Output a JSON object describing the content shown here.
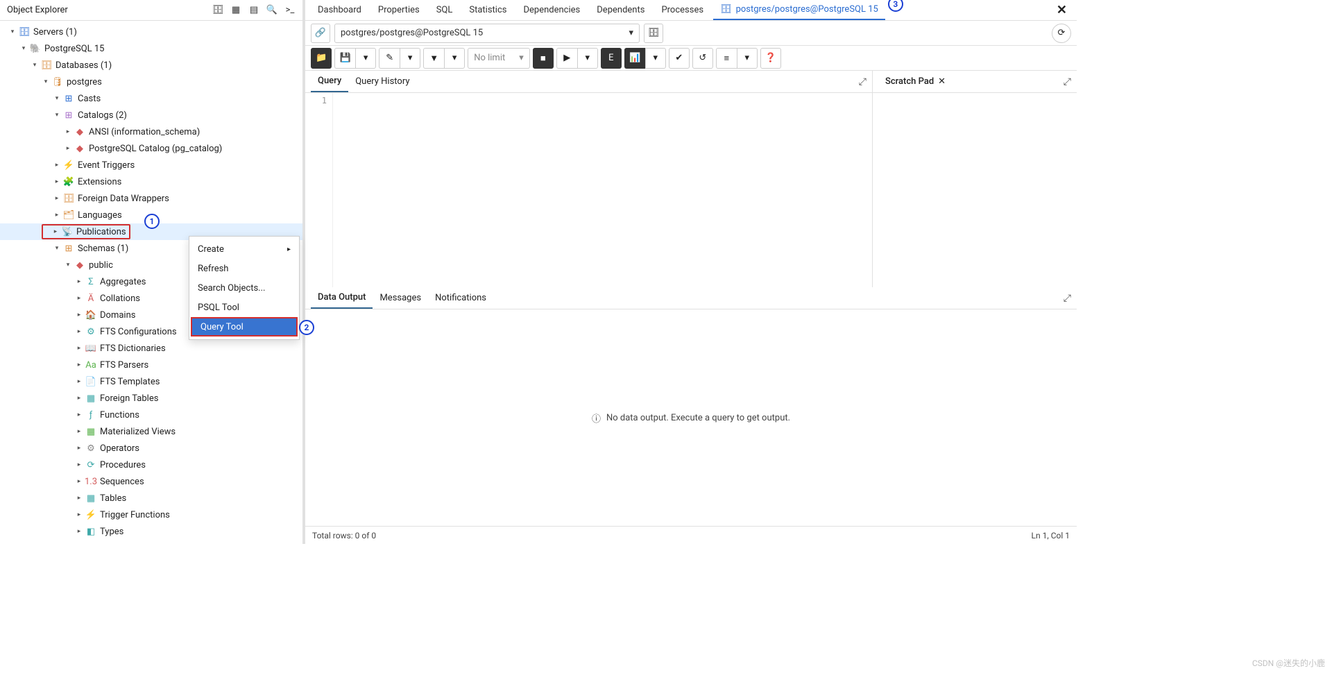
{
  "explorer": {
    "title": "Object Explorer",
    "tree": {
      "servers": "Servers (1)",
      "pg15": "PostgreSQL 15",
      "databases": "Databases (1)",
      "postgres": "postgres",
      "casts": "Casts",
      "catalogs": "Catalogs (2)",
      "ansi": "ANSI (information_schema)",
      "pgcatalog": "PostgreSQL Catalog (pg_catalog)",
      "event_triggers": "Event Triggers",
      "extensions": "Extensions",
      "fdw": "Foreign Data Wrappers",
      "languages": "Languages",
      "publications": "Publications",
      "schemas": "Schemas (1)",
      "public": "public",
      "aggregates": "Aggregates",
      "collations": "Collations",
      "domains": "Domains",
      "fts_conf": "FTS Configurations",
      "fts_dict": "FTS Dictionaries",
      "fts_parsers": "FTS Parsers",
      "fts_templates": "FTS Templates",
      "foreign_tables": "Foreign Tables",
      "functions": "Functions",
      "mat_views": "Materialized Views",
      "operators": "Operators",
      "procedures": "Procedures",
      "sequences": "Sequences",
      "tables": "Tables",
      "trigger_funcs": "Trigger Functions",
      "types": "Types"
    }
  },
  "context_menu": {
    "create": "Create",
    "refresh": "Refresh",
    "search": "Search Objects...",
    "psql": "PSQL Tool",
    "query": "Query Tool"
  },
  "tabs": {
    "dashboard": "Dashboard",
    "properties": "Properties",
    "sql": "SQL",
    "statistics": "Statistics",
    "dependencies": "Dependencies",
    "dependents": "Dependents",
    "processes": "Processes",
    "query_tab": "postgres/postgres@PostgreSQL 15"
  },
  "connection": {
    "value": "postgres/postgres@PostgreSQL 15"
  },
  "toolbar": {
    "no_limit": "No limit"
  },
  "editor": {
    "query_tab": "Query",
    "history_tab": "Query History",
    "line1": "1",
    "scratch": "Scratch Pad"
  },
  "output": {
    "data_output": "Data Output",
    "messages": "Messages",
    "notifications": "Notifications",
    "empty": "No data output. Execute a query to get output."
  },
  "status": {
    "rows": "Total rows: 0 of 0",
    "footer_right": "Ln 1, Col 1"
  },
  "annotations": {
    "a1": "1",
    "a2": "2",
    "a3": "3"
  },
  "watermark": "CSDN @迷失的小鹿"
}
